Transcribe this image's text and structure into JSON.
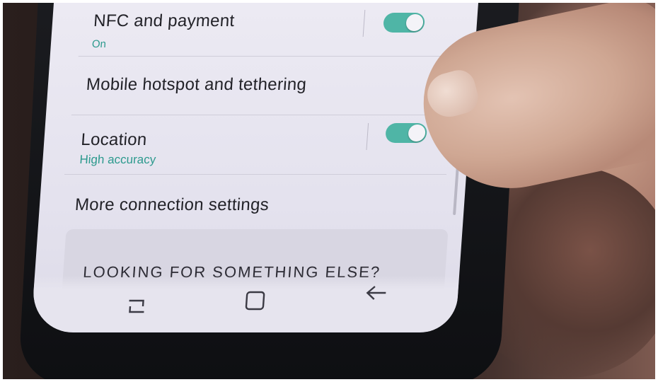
{
  "settings": {
    "nfc": {
      "title": "NFC and payment",
      "status": "On"
    },
    "hotspot": {
      "title": "Mobile hotspot and tethering"
    },
    "location": {
      "title": "Location",
      "status": "High accuracy"
    },
    "more": {
      "title": "More connection settings"
    }
  },
  "card": {
    "title": "LOOKING FOR SOMETHING ELSE?"
  },
  "navbar": {
    "recent_icon": "recent-apps-icon",
    "home_icon": "home-icon",
    "back_icon": "back-icon"
  },
  "colors": {
    "toggle_on": "#4fb5a6",
    "status_text": "#2d9a8e",
    "screen_bg": "#e8e6f0"
  },
  "toggles": {
    "nfc_on": true,
    "location_on": true
  }
}
